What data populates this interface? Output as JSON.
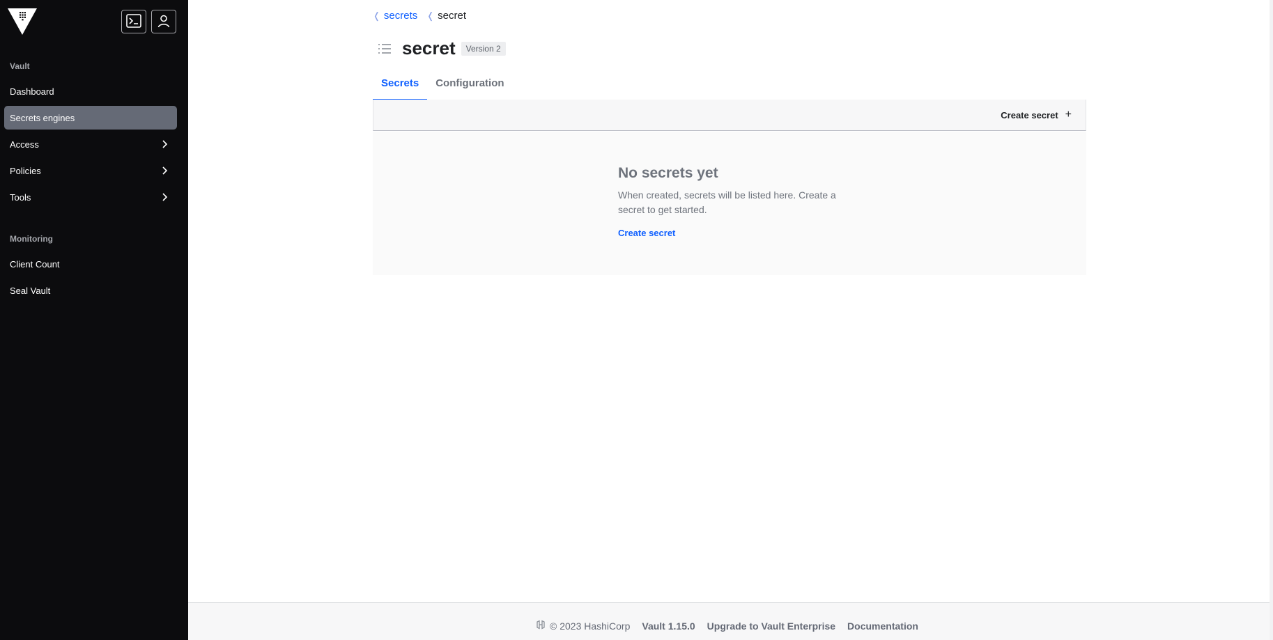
{
  "sidebar": {
    "logo": "vault-logo",
    "top_buttons": [
      {
        "icon": "terminal-icon"
      },
      {
        "icon": "user-icon"
      }
    ],
    "sections": [
      {
        "title": "Vault",
        "items": [
          {
            "label": "Dashboard",
            "has_chevron": false,
            "active": false
          },
          {
            "label": "Secrets engines",
            "has_chevron": false,
            "active": true
          },
          {
            "label": "Access",
            "has_chevron": true,
            "active": false
          },
          {
            "label": "Policies",
            "has_chevron": true,
            "active": false
          },
          {
            "label": "Tools",
            "has_chevron": true,
            "active": false
          }
        ]
      },
      {
        "title": "Monitoring",
        "items": [
          {
            "label": "Client Count",
            "has_chevron": false,
            "active": false
          },
          {
            "label": "Seal Vault",
            "has_chevron": false,
            "active": false
          }
        ]
      }
    ]
  },
  "breadcrumb": {
    "items": [
      {
        "label": "secrets",
        "link": true
      },
      {
        "label": "secret",
        "link": false
      }
    ]
  },
  "header": {
    "title": "secret",
    "version_badge": "Version 2",
    "icon": "list-icon"
  },
  "tabs": [
    {
      "label": "Secrets",
      "active": true
    },
    {
      "label": "Configuration",
      "active": false
    }
  ],
  "toolbar": {
    "create_label": "Create secret",
    "create_icon": "+"
  },
  "empty_state": {
    "title": "No secrets yet",
    "message": "When created, secrets will be listed here. Create a secret to get started.",
    "link": "Create secret"
  },
  "footer": {
    "copyright": "© 2023 HashiCorp",
    "version": "Vault 1.15.0",
    "upgrade": "Upgrade to Vault Enterprise",
    "docs": "Documentation"
  },
  "colors": {
    "sidebar_bg": "#0c0c0e",
    "active_nav": "#656a76",
    "accent": "#1060ff"
  }
}
